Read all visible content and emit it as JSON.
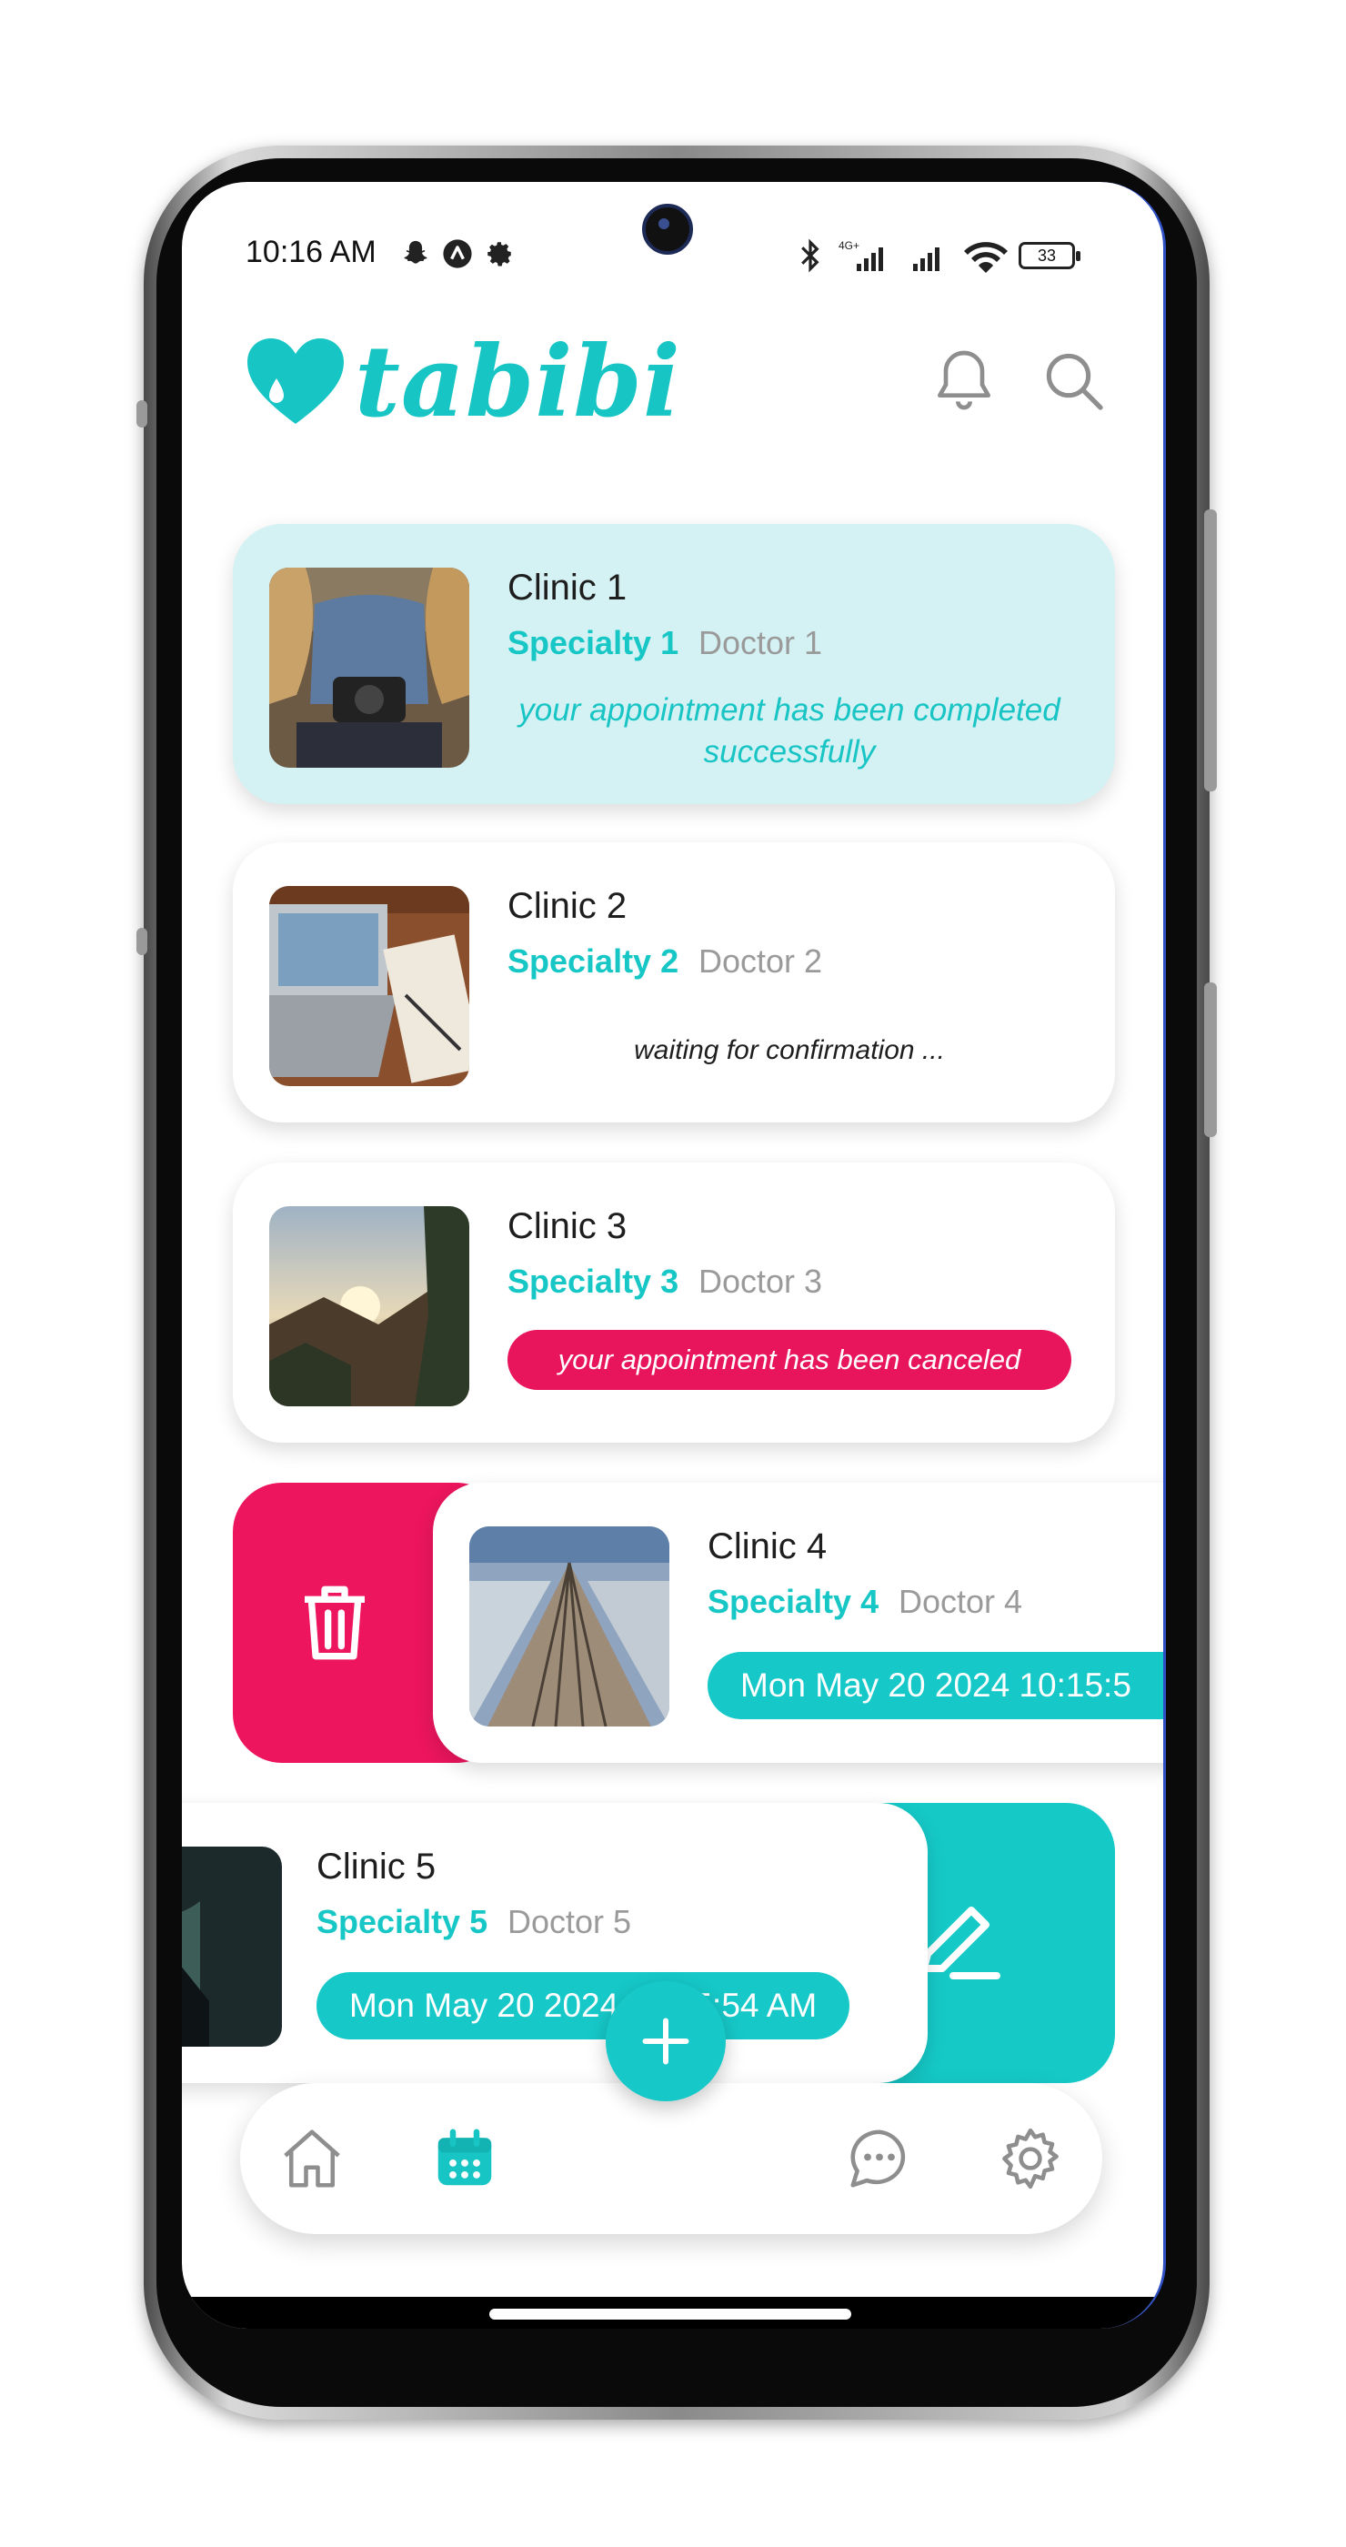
{
  "status_bar": {
    "time": "10:16 AM",
    "network": "4G+",
    "battery": "33",
    "icons": [
      "snapchat-icon",
      "app-icon",
      "settings-icon",
      "bluetooth-icon",
      "signal-icon",
      "wifi-icon"
    ]
  },
  "header": {
    "logo_text": "tabibi",
    "icons": [
      "bell-icon",
      "search-icon"
    ]
  },
  "appointments": [
    {
      "clinic": "Clinic 1",
      "specialty": "Specialty 1",
      "doctor": "Doctor 1",
      "status": "completed",
      "message": "your appointment has been completed successfully"
    },
    {
      "clinic": "Clinic 2",
      "specialty": "Specialty 2",
      "doctor": "Doctor 2",
      "status": "pending",
      "message": "waiting for confirmation ..."
    },
    {
      "clinic": "Clinic 3",
      "specialty": "Specialty 3",
      "doctor": "Doctor 3",
      "status": "canceled",
      "message": "your appointment has been canceled"
    },
    {
      "clinic": "Clinic 4",
      "specialty": "Specialty 4",
      "doctor": "Doctor 4",
      "status": "scheduled",
      "date": "Mon May 20 2024  10:15:5",
      "swipe_action": "delete"
    },
    {
      "clinic": "Clinic 5",
      "specialty": "Specialty 5",
      "doctor": "Doctor 5",
      "status": "scheduled",
      "date": "Mon May 20 2024  10:15:54 AM",
      "swipe_action": "edit"
    }
  ],
  "bottom_nav": {
    "items": [
      "home-icon",
      "calendar-icon",
      "chat-icon",
      "settings-icon"
    ],
    "active": "calendar-icon",
    "fab": "add-icon"
  },
  "colors": {
    "accent": "#16c8c8",
    "completed_bg": "#d4f2f3",
    "cancel": "#e8155c",
    "delete": "#ec155e"
  }
}
